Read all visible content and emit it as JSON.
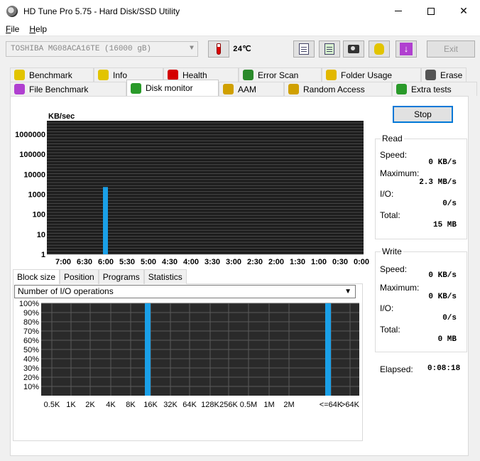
{
  "window": {
    "title": "HD Tune Pro 5.75 - Hard Disk/SSD Utility"
  },
  "menu": [
    {
      "key": "F",
      "rest": "ile"
    },
    {
      "key": "H",
      "rest": "elp"
    }
  ],
  "toolbar": {
    "drive": "TOSHIBA MG08ACA16TE (16000 gB)",
    "temperature": "24℃",
    "exit_label": "Exit"
  },
  "tabs_row1": [
    {
      "label": "Benchmark",
      "icon": "benchmark-icon",
      "color": "#e2c400"
    },
    {
      "label": "Info",
      "icon": "info-icon",
      "color": "#e2c400"
    },
    {
      "label": "Health",
      "icon": "health-icon",
      "color": "#d40000"
    },
    {
      "label": "Error Scan",
      "icon": "magnifier-icon",
      "color": "#2a8a2a"
    },
    {
      "label": "Folder Usage",
      "icon": "folder-icon",
      "color": "#e2b800"
    },
    {
      "label": "Erase",
      "icon": "trash-icon",
      "color": "#555555"
    }
  ],
  "tabs_row2": [
    {
      "label": "File Benchmark",
      "icon": "file-benchmark-icon",
      "color": "#b040d0"
    },
    {
      "label": "Disk monitor",
      "icon": "disk-monitor-icon",
      "color": "#2a9a2a",
      "active": true
    },
    {
      "label": "AAM",
      "icon": "speaker-icon",
      "color": "#d0a000"
    },
    {
      "label": "Random Access",
      "icon": "random-access-icon",
      "color": "#d0a000"
    },
    {
      "label": "Extra tests",
      "icon": "extra-tests-icon",
      "color": "#2a9a2a"
    }
  ],
  "stop_label": "Stop",
  "read": {
    "title": "Read",
    "speed_label": "Speed:",
    "speed": "0 KB/s",
    "max_label": "Maximum:",
    "max": "2.3 MB/s",
    "io_label": "I/O:",
    "io": "0/s",
    "total_label": "Total:",
    "total": "15 MB"
  },
  "write": {
    "title": "Write",
    "speed_label": "Speed:",
    "speed": "0 KB/s",
    "max_label": "Maximum:",
    "max": "0 KB/s",
    "io_label": "I/O:",
    "io": "0/s",
    "total_label": "Total:",
    "total": "0 MB"
  },
  "elapsed": {
    "label": "Elapsed:",
    "value": "0:08:18"
  },
  "subtabs": [
    "Block size",
    "Position",
    "Programs",
    "Statistics"
  ],
  "io_select": "Number of I/O operations",
  "colors": {
    "accent": "#0078d7",
    "bar": "#1aa0e8",
    "plot_bg": "#1c1c1c"
  },
  "chart_data": [
    {
      "type": "bar",
      "ylabel": "KB/sec",
      "y_scale": "log",
      "ylim": [
        1,
        1000000
      ],
      "y_ticks": [
        "1000000",
        "100000",
        "10000",
        "1000",
        "100",
        "10",
        "1"
      ],
      "x_ticks": [
        "7:00",
        "6:30",
        "6:00",
        "5:30",
        "5:00",
        "4:30",
        "4:00",
        "3:30",
        "3:00",
        "2:30",
        "2:00",
        "1:30",
        "1:00",
        "0:30",
        "0:00"
      ],
      "series": [
        {
          "values": [
            {
              "x": "6:00",
              "y": 2300
            }
          ]
        }
      ]
    },
    {
      "type": "bar",
      "y_ticks": [
        "100%",
        "90%",
        "80%",
        "70%",
        "60%",
        "50%",
        "40%",
        "30%",
        "20%",
        "10%"
      ],
      "ylim": [
        0,
        100
      ],
      "categories": [
        "0.5K",
        "1K",
        "2K",
        "4K",
        "8K",
        "16K",
        "32K",
        "64K",
        "128K",
        "256K",
        "0.5M",
        "1M",
        "2M",
        "<=64K",
        ">64K"
      ],
      "values": [
        0,
        0,
        0,
        0,
        0,
        100,
        0,
        0,
        0,
        0,
        0,
        0,
        0,
        100,
        0
      ]
    }
  ]
}
